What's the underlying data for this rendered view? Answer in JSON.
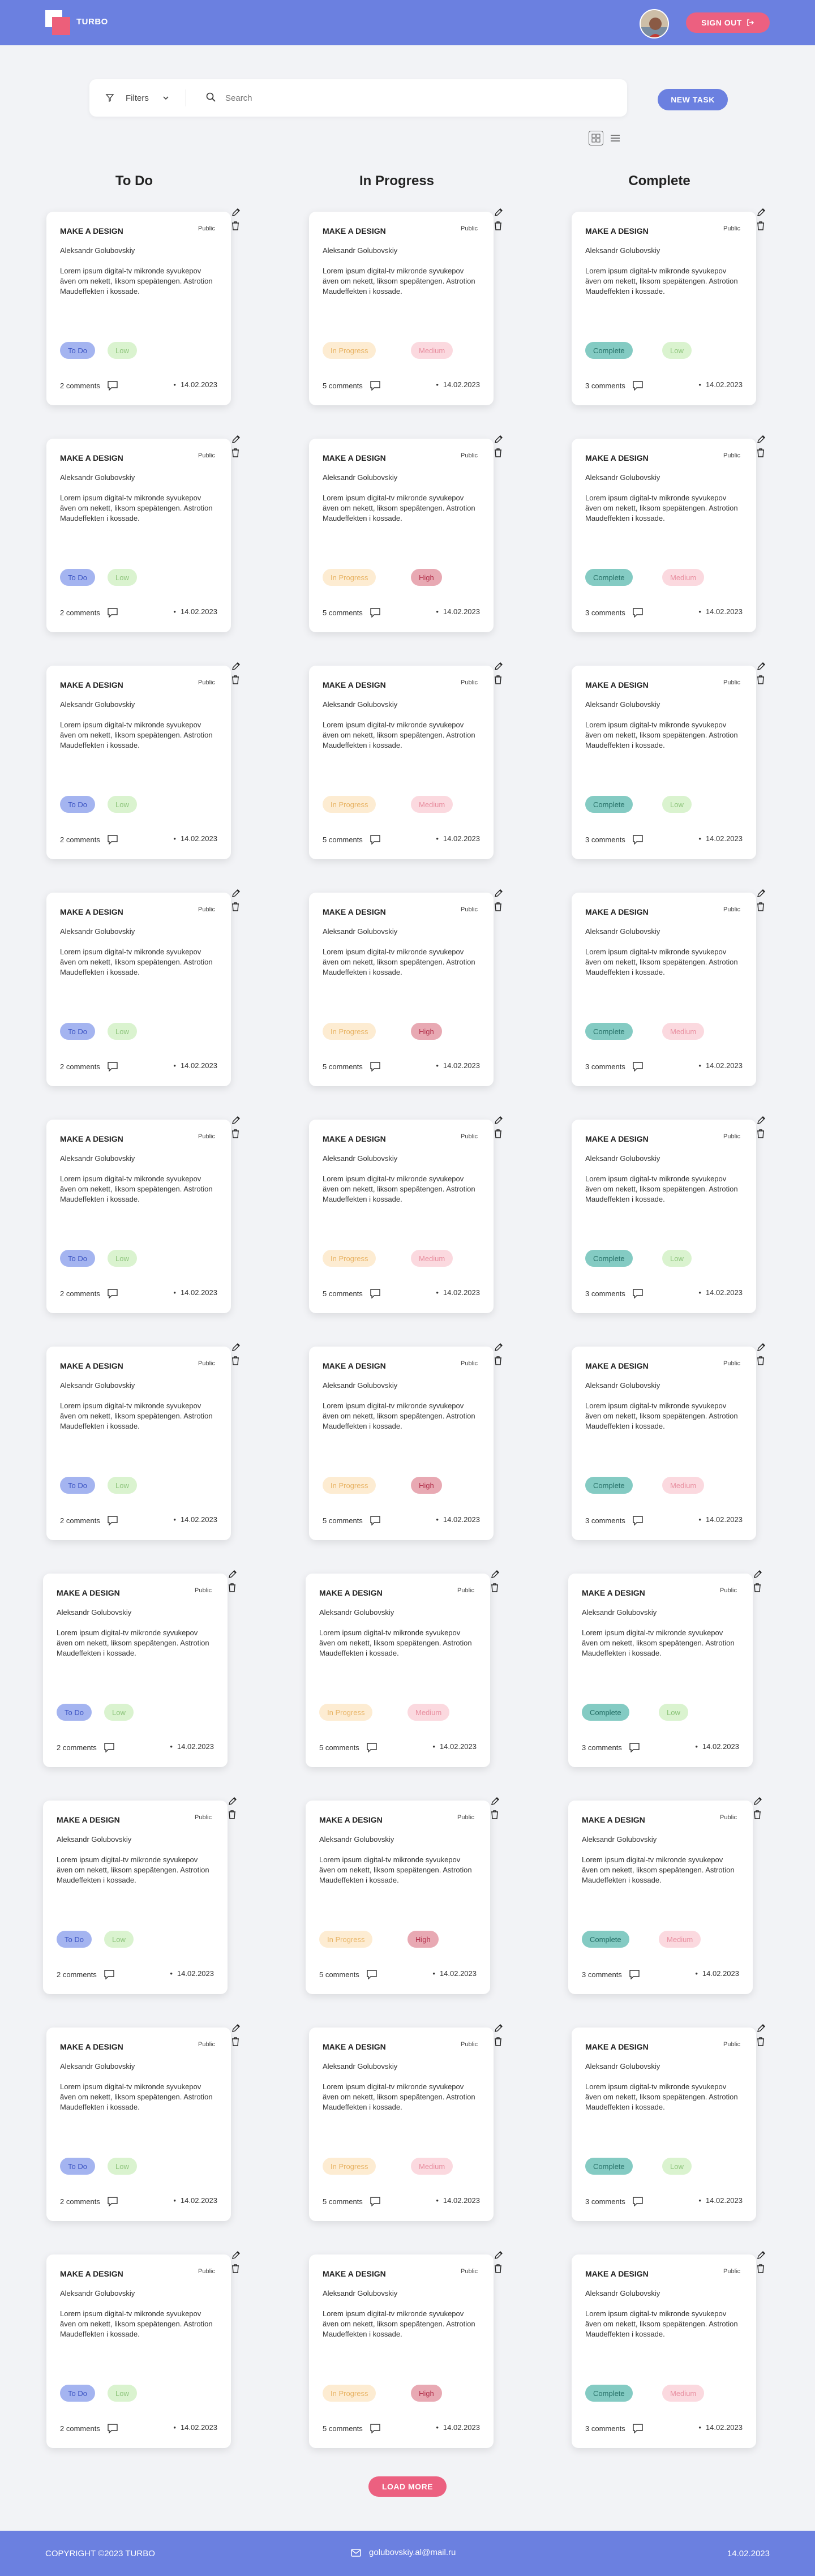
{
  "header": {
    "brand": "TURBO",
    "signout_label": "SIGN OUT"
  },
  "toolbar": {
    "filters_label": "Filters",
    "search_placeholder": "Search",
    "new_task_label": "NEW TASK"
  },
  "columns": [
    "To Do",
    "In Progress",
    "Complete"
  ],
  "card_template": {
    "title": "MAKE A DESIGN",
    "visibility": "Public",
    "author": "Aleksandr Golubovskiy",
    "description": "Lorem ipsum digital-tv mikronde syvukepov även om nekett, liksom spepätengen. Astrotion Maudeffekten i kossade.",
    "date": "14.02.2023"
  },
  "status_labels": {
    "todo": "To Do",
    "inprogress": "In Progress",
    "complete": "Complete"
  },
  "priority_labels": {
    "low": "Low",
    "medium": "Medium",
    "high": "High"
  },
  "comments": {
    "todo": "2 comments",
    "inprogress": "5 comments",
    "complete": "3 comments"
  },
  "rows": [
    {
      "todo": "low",
      "inprogress": "medium",
      "complete": "low"
    },
    {
      "todo": "low",
      "inprogress": "high",
      "complete": "medium"
    },
    {
      "todo": "low",
      "inprogress": "medium",
      "complete": "low"
    },
    {
      "todo": "low",
      "inprogress": "high",
      "complete": "medium"
    },
    {
      "todo": "low",
      "inprogress": "medium",
      "complete": "low"
    },
    {
      "todo": "low",
      "inprogress": "high",
      "complete": "medium"
    },
    {
      "todo": "low",
      "inprogress": "medium",
      "complete": "low"
    },
    {
      "todo": "low",
      "inprogress": "high",
      "complete": "medium"
    },
    {
      "todo": "low",
      "inprogress": "medium",
      "complete": "low"
    },
    {
      "todo": "low",
      "inprogress": "high",
      "complete": "medium"
    }
  ],
  "load_more_label": "LOAD MORE",
  "footer": {
    "copyright": "COPYRIGHT ©2023 TURBO",
    "email": "golubovskiy.al@mail.ru",
    "date": "14.02.2023"
  },
  "colors": {
    "primary": "#6b80e0",
    "accent": "#ec6080",
    "background": "#f2f3f6"
  }
}
